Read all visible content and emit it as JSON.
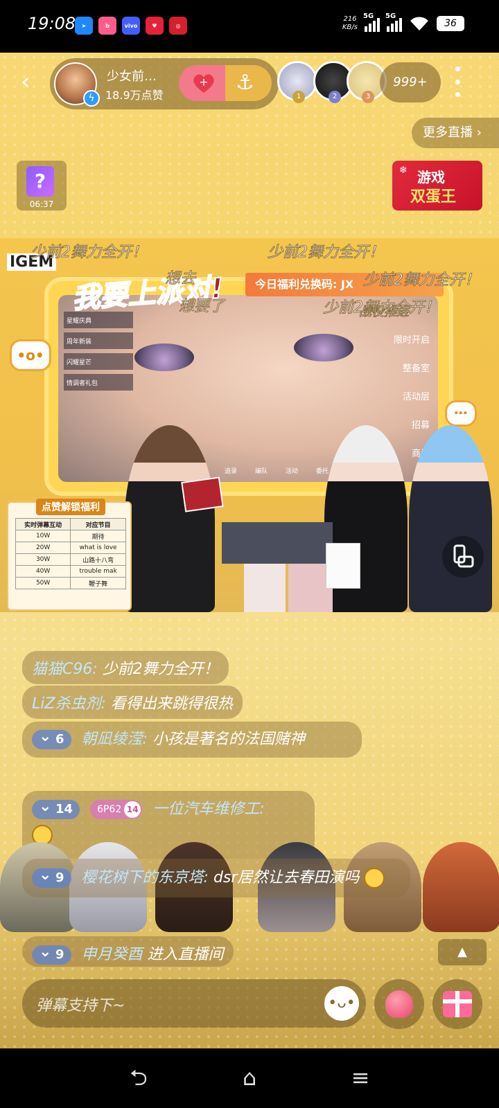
{
  "status_bar": {
    "time": "19:08",
    "apps": [
      {
        "name": "feishu-icon",
        "color": "#1e88ff",
        "glyph": "➤"
      },
      {
        "name": "bilibili-icon",
        "color": "#ff5c8d",
        "glyph": "b"
      },
      {
        "name": "vivo-icon",
        "color": "#415fff",
        "glyph": "vivo"
      },
      {
        "name": "heart-app-icon",
        "color": "#e8213b",
        "glyph": "♥"
      },
      {
        "name": "bank-app-icon",
        "color": "#d4202a",
        "glyph": "◎"
      }
    ],
    "net_speed_value": "216",
    "net_speed_unit": "KB/s",
    "sim1": "5G",
    "sim2": "5G",
    "battery": "36"
  },
  "header": {
    "host_name": "少女前…",
    "host_likes": "18.9万点赞",
    "viewer_count": "999+",
    "more_live": "更多直播",
    "viewer_ranks": [
      "1",
      "2",
      "3"
    ]
  },
  "widgets": {
    "mystery_timer": "06:37",
    "mystery_symbol": "?",
    "game_badge_line1": "游戏",
    "game_badge_line2": "双蛋王"
  },
  "stage": {
    "logo": "IGEM",
    "party_banner": "我要上派对!",
    "redeem_banner": "今日福利兑换码: JX",
    "bubble_left": "•o•",
    "game_menu": [
      "限时开启",
      "整备室",
      "活动层",
      "招募",
      "商城"
    ],
    "game_left_list": [
      "星耀庆典",
      "周年新装",
      "闪耀星芒",
      "情调者礼包"
    ],
    "game_bottom": [
      "追录",
      "编队",
      "活动",
      "委托"
    ],
    "floating_danmu": [
      "少前2舞力全开！",
      "少前2舞力全开！",
      "少前2舞力全开！",
      "少前2舞力全开！",
      "想去",
      "想要了",
      "战役推进"
    ],
    "fan_table": {
      "title": "点赞解锁福利",
      "headers": [
        "实时弹幕互动",
        "对应节目"
      ],
      "rows": [
        [
          "10W",
          "期待"
        ],
        [
          "20W",
          "what is love"
        ],
        [
          "30W",
          "山路十八弯"
        ],
        [
          "40W",
          "trouble mak"
        ],
        [
          "50W",
          "鞭子舞"
        ]
      ]
    }
  },
  "chat": {
    "messages": [
      {
        "user": "猫猫C96:",
        "text": "少前2舞力全开！"
      },
      {
        "user": "LiZ杀虫剂:",
        "text": "看得出来跳得很热"
      },
      {
        "level": "6",
        "user": "朝凪绫滢:",
        "text": "小孩是著名的法国赌神"
      },
      {
        "level": "14",
        "fan_badge": "6P62",
        "fan_level": "14",
        "user": "一位汽车维修工:",
        "text": ""
      },
      {
        "level": "9",
        "user": "樱花树下的东京塔:",
        "text": "dsr居然让去春田演吗"
      }
    ],
    "enter_notice": {
      "level": "9",
      "user": "申月癸酉",
      "text": "进入直播间"
    },
    "up_arrow": "▲",
    "input_placeholder": "弹幕支持下~",
    "emoji_button": "•ᴗ•"
  },
  "navbar": {
    "back": "⮌",
    "home": "⌂",
    "menu": "≡"
  },
  "colors": {
    "accent_yellow": "#f5d56e",
    "chat_user": "#c3e6f7",
    "level_pill": "#5c82d2",
    "fan_badge": "#d77fae"
  }
}
